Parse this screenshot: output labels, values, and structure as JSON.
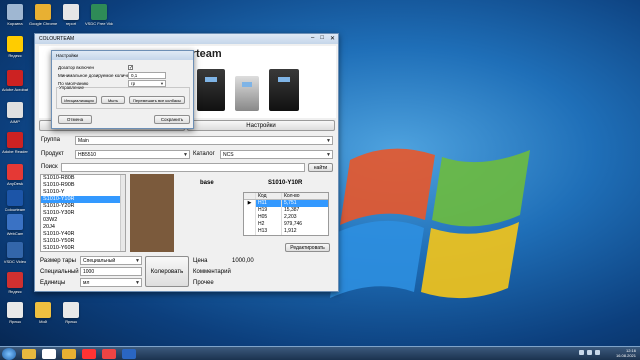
{
  "desktop": {
    "icons": [
      {
        "label": "Корзина",
        "icon": "recycle-bin-icon",
        "color": "#9fb7d2"
      },
      {
        "label": "Google Chrome",
        "icon": "chrome-icon",
        "color": "#e8b032"
      },
      {
        "label": "report",
        "icon": "file-icon",
        "color": "#e6e6e6"
      },
      {
        "label": "VSDC Free Video Editor",
        "icon": "video-editor-icon",
        "color": "#2e8b57"
      },
      {
        "label": "Яндекс",
        "icon": "yandex-icon",
        "color": "#ffcc00"
      },
      {
        "label": "Adobe Acrobat",
        "icon": "acrobat-icon",
        "color": "#cc2222"
      },
      {
        "label": "AIMP",
        "icon": "aimp-icon",
        "color": "#e0e0e0"
      },
      {
        "label": "Adobe Reader",
        "icon": "reader-icon",
        "color": "#cc2222"
      },
      {
        "label": "AnyDesk",
        "icon": "anydesk-icon",
        "color": "#e53935"
      },
      {
        "label": "Colourteam",
        "icon": "app-icon",
        "color": "#1c55a8"
      },
      {
        "label": "WebCam",
        "icon": "webcam-icon",
        "color": "#3a72c4"
      },
      {
        "label": "VSDC Video",
        "icon": "video-icon",
        "color": "#3366aa"
      },
      {
        "label": "Яндекс",
        "icon": "yandex-icon",
        "color": "#d03030"
      },
      {
        "label": "Ярлык",
        "icon": "shortcut-icon",
        "color": "#e9e9e9"
      },
      {
        "label": "Мой",
        "icon": "folder-icon",
        "color": "#f0c040"
      },
      {
        "label": "Ярлык",
        "icon": "shortcut-icon",
        "color": "#e9e9e9"
      }
    ]
  },
  "main_window": {
    "title": "COLOURTEAM",
    "brand": "urteam",
    "tab_left": "",
    "tab_settings": "Настройки",
    "group_label": "Группа",
    "group_value": "Main",
    "product_label": "Продукт",
    "product_value": "HB5510",
    "catalog_label": "Каталог",
    "catalog_value": "NCS",
    "search_label": "Поиск",
    "search_value": "",
    "search_button": "найти",
    "colors": [
      "S1010-R80B",
      "S1010-R90B",
      "S1010-Y",
      "S1010-Y10R",
      "S1010-Y20R",
      "S1010-Y30R",
      "03W2",
      "20J4",
      "S1010-Y40R",
      "S1010-Y50R",
      "S1010-Y60R"
    ],
    "selected_color_index": 3,
    "base_label": "base",
    "color_name": "S1010-Y10R",
    "grid_headers": [
      "Код",
      "Кол-во"
    ],
    "grid_rows": [
      {
        "code": "H11",
        "qty": "5,751"
      },
      {
        "code": "H19",
        "qty": "15,387"
      },
      {
        "code": "H05",
        "qty": "2,203"
      },
      {
        "code": "H2",
        "qty": "979,746"
      },
      {
        "code": "H13",
        "qty": "1,912"
      }
    ],
    "edit_button": "Редактировать",
    "tare_label": "Размер тары",
    "tare_value": "Специальный",
    "special_label": "Специальный",
    "special_value": "1000",
    "units_label": "Единицы",
    "units_value": "мл",
    "colorize_button": "Колеровать",
    "price_label": "Цена",
    "price_value": "1000,00",
    "comments_label": "Комментарий",
    "other_label": "Прочее",
    "swatch_color": "#7b5a3c"
  },
  "settings_dialog": {
    "title": "Настройки",
    "dispenser_label": "Дозатор включен",
    "dispenser_checked": true,
    "min_dose_label": "Минимальное дозируемое количество",
    "min_dose_value": "0,1",
    "default_label": "По умолчанию",
    "default_value": "гр",
    "management_label": "Управление",
    "init_button": "Инициализация",
    "wash_button": "Мыть",
    "clean_button": "Перемешать все колбасы",
    "cancel_button": "Отмена",
    "save_button": "Сохранить"
  },
  "taskbar": {
    "time": "12:16",
    "date": "16.08.2021",
    "apps": [
      {
        "icon": "explorer-icon",
        "color": "#e7b93e"
      },
      {
        "icon": "yandex-browser-icon",
        "color": "#ffffff"
      },
      {
        "icon": "chrome-icon",
        "color": "#e8b032"
      },
      {
        "icon": "yandex-icon",
        "color": "#ff3333"
      },
      {
        "icon": "app-icon",
        "color": "#ee4444"
      },
      {
        "icon": "colourteam-icon",
        "color": "#2a66c2"
      }
    ]
  }
}
